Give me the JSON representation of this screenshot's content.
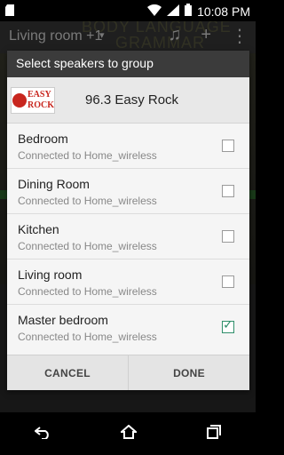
{
  "status_bar": {
    "time": "10:08 PM",
    "icons": [
      "sd-card-icon",
      "wifi-icon",
      "signal-icon",
      "battery-icon"
    ]
  },
  "background_app": {
    "room_label": "Living room +1",
    "bg_text_line1": "BODY LANGUAGE",
    "bg_text_line2": "GRAMMAR",
    "actions": [
      "music-icon",
      "plus-icon",
      "overflow-icon"
    ]
  },
  "dialog": {
    "title": "Select speakers to group",
    "station": {
      "logo_line1": "EASY",
      "logo_line2": "ROCK",
      "name": "96.3 Easy Rock"
    },
    "speakers": [
      {
        "name": "Bedroom",
        "status": "Connected to Home_wireless",
        "checked": false
      },
      {
        "name": "Dining Room",
        "status": "Connected to Home_wireless",
        "checked": false
      },
      {
        "name": "Kitchen",
        "status": "Connected to Home_wireless",
        "checked": false
      },
      {
        "name": "Living room",
        "status": "Connected to Home_wireless",
        "checked": false
      },
      {
        "name": "Master bedroom",
        "status": "Connected to Home_wireless",
        "checked": true
      }
    ],
    "cancel_label": "CANCEL",
    "done_label": "DONE"
  },
  "colors": {
    "accent": "#2f8f6a",
    "header": "#3b3b3b",
    "logo_red": "#c8261e"
  },
  "nav": [
    "back-icon",
    "home-icon",
    "recents-icon"
  ]
}
